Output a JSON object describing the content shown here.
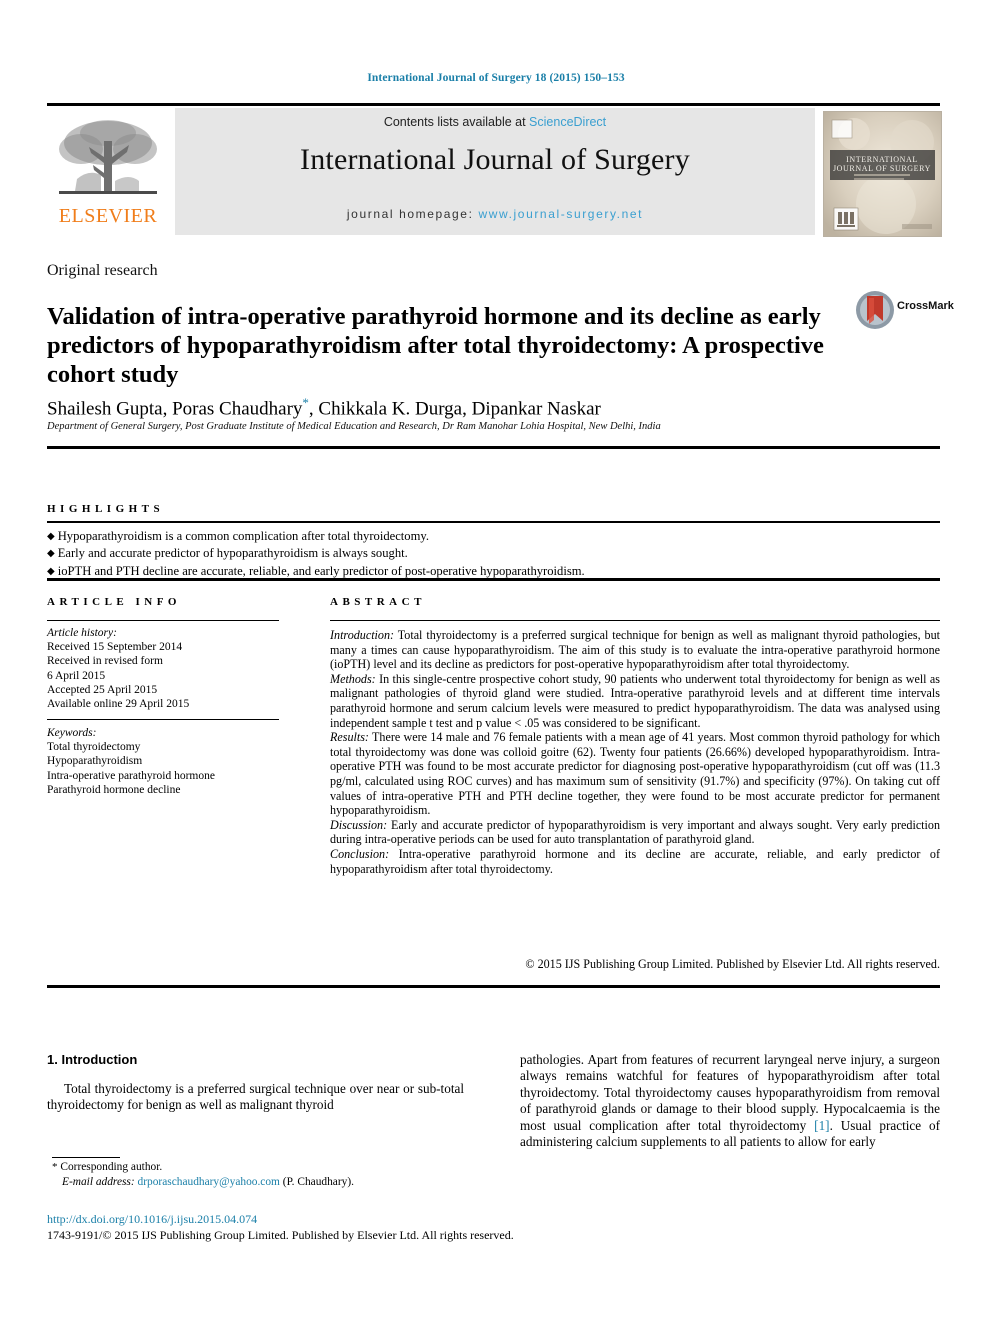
{
  "running_head": "International Journal of Surgery 18 (2015) 150–153",
  "masthead": {
    "contents_prefix": "Contents lists available at ",
    "sciencedirect": "ScienceDirect",
    "journal_title": "International Journal of Surgery",
    "homepage_label": "journal homepage: ",
    "homepage_url": "www.journal-surgery.net",
    "publisher": "ELSEVIER",
    "cover_title": "INTERNATIONAL JOURNAL OF SURGERY",
    "colors": {
      "link": "#3a9fd0",
      "elsevier_orange": "#f07d1a",
      "panel": "#e6e6e6",
      "running_head": "#1a7fa8"
    }
  },
  "article": {
    "type": "Original research",
    "title": "Validation of intra-operative parathyroid hormone and its decline as early predictors of hypoparathyroidism after total thyroidectomy: A prospective cohort study",
    "authors": "Shailesh Gupta, Poras Chaudhary",
    "authors_rest": ", Chikkala K. Durga, Dipankar Naskar",
    "affiliation": "Department of General Surgery, Post Graduate Institute of Medical Education and Research, Dr Ram Manohar Lohia Hospital, New Delhi, India",
    "crossmark_label": "CrossMark"
  },
  "highlights": {
    "heading": "HIGHLIGHTS",
    "items": [
      "Hypoparathyroidism is a common complication after total thyroidectomy.",
      "Early and accurate predictor of hypoparathyroidism is always sought.",
      "ioPTH and PTH decline are accurate, reliable, and early predictor of post-operative hypoparathyroidism."
    ]
  },
  "article_info": {
    "heading": "ARTICLE INFO",
    "history_label": "Article history:",
    "history": [
      "Received 15 September 2014",
      "Received in revised form",
      "6 April 2015",
      "Accepted 25 April 2015",
      "Available online 29 April 2015"
    ],
    "keywords_label": "Keywords:",
    "keywords": [
      "Total thyroidectomy",
      "Hypoparathyroidism",
      "Intra-operative parathyroid hormone",
      "Parathyroid hormone decline"
    ]
  },
  "abstract": {
    "heading": "ABSTRACT",
    "sections": [
      {
        "label": "Introduction:",
        "text": " Total thyroidectomy is a preferred surgical technique for benign as well as malignant thyroid pathologies, but many a times can cause hypoparathyroidism. The aim of this study is to evaluate the intra-operative parathyroid hormone (ioPTH) level and its decline as predictors for post-operative hypoparathyroidism after total thyroidectomy."
      },
      {
        "label": "Methods:",
        "text": " In this single-centre prospective cohort study, 90 patients who underwent total thyroidectomy for benign as well as malignant pathologies of thyroid gland were studied. Intra-operative parathyroid levels and at different time intervals parathyroid hormone and serum calcium levels were measured to predict hypoparathyroidism. The data was analysed using independent sample t test and p value < .05 was considered to be significant."
      },
      {
        "label": "Results:",
        "text": " There were 14 male and 76 female patients with a mean age of 41 years. Most common thyroid pathology for which total thyroidectomy was done was colloid goitre (62). Twenty four patients (26.66%) developed hypoparathyroidism. Intra-operative PTH was found to be most accurate predictor for diagnosing post-operative hypoparathyroidism (cut off was (11.3 pg/ml, calculated using ROC curves) and has maximum sum of sensitivity (91.7%) and specificity (97%). On taking cut off values of intra-operative PTH and PTH decline together, they were found to be most accurate predictor for permanent hypoparathyroidism."
      },
      {
        "label": "Discussion:",
        "text": " Early and accurate predictor of hypoparathyroidism is very important and always sought. Very early prediction during intra-operative periods can be used for auto transplantation of parathyroid gland."
      },
      {
        "label": "Conclusion:",
        "text": " Intra-operative parathyroid hormone and its decline are accurate, reliable, and early predictor of hypoparathyroidism after total thyroidectomy."
      }
    ],
    "copyright": "© 2015 IJS Publishing Group Limited. Published by Elsevier Ltd. All rights reserved."
  },
  "body": {
    "section_number_title": "1. Introduction",
    "left_paragraph": "Total thyroidectomy is a preferred surgical technique over near or sub-total thyroidectomy for benign as well as malignant thyroid",
    "right_paragraph_a": "pathologies. Apart from features of recurrent laryngeal nerve injury, a surgeon always remains watchful for features of hypoparathyroidism after total thyroidectomy. Total thyroidectomy causes hypoparathyroidism from removal of parathyroid glands or damage to their blood supply. Hypocalcaemia is the most usual complication after total thyroidectomy ",
    "citation": "[1]",
    "right_paragraph_b": ". Usual practice of administering calcium supplements to all patients to allow for early"
  },
  "footnote": {
    "corresponding": "Corresponding author.",
    "email_label": "E-mail address:",
    "email": "drporaschaudhary@yahoo.com",
    "email_owner": "(P. Chaudhary)."
  },
  "page_footer": {
    "doi": "http://dx.doi.org/10.1016/j.ijsu.2015.04.074",
    "issn_line": "1743-9191/© 2015 IJS Publishing Group Limited. Published by Elsevier Ltd. All rights reserved."
  }
}
